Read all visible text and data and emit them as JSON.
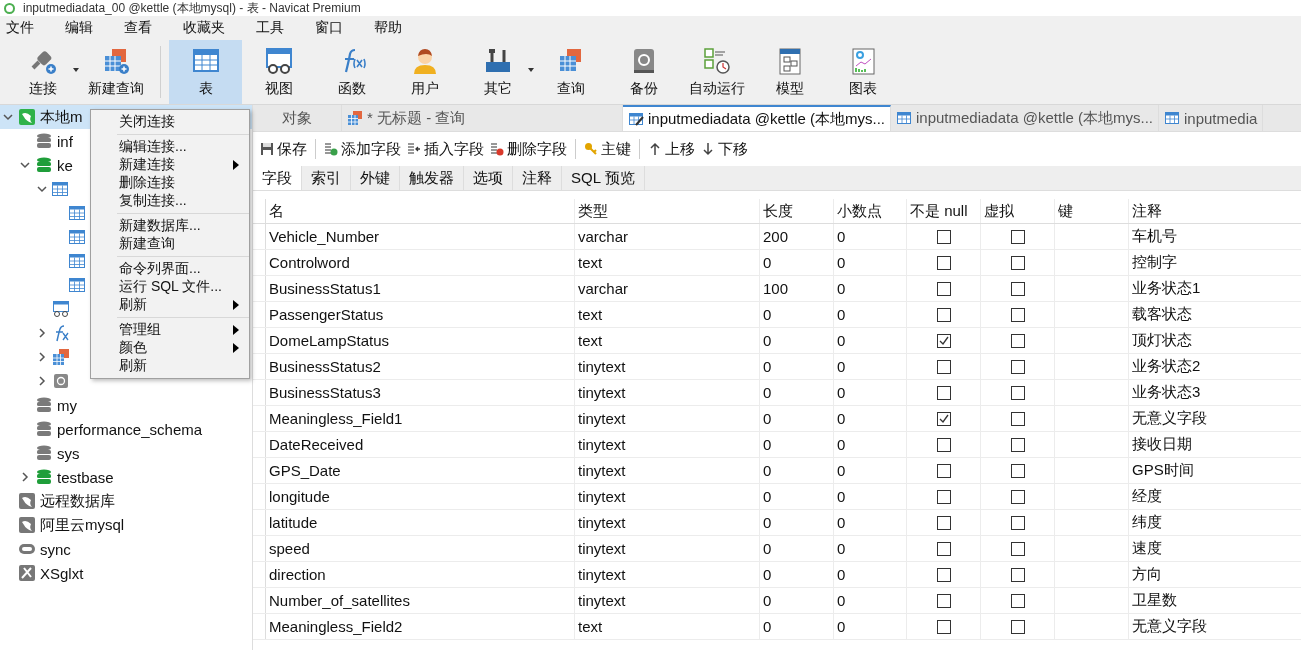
{
  "window": {
    "title": "inputmediadata_00 @kettle (本地mysql) - 表 - Navicat Premium"
  },
  "menu_bar": [
    "文件",
    "编辑",
    "查看",
    "收藏夹",
    "工具",
    "窗口",
    "帮助"
  ],
  "toolbar": [
    {
      "label": "连接",
      "kind": "connect",
      "dropdown": true,
      "selected": false
    },
    {
      "label": "新建查询",
      "kind": "new-query",
      "dropdown": false,
      "selected": false
    },
    {
      "label": "表",
      "kind": "table",
      "dropdown": false,
      "selected": true,
      "group_start": true
    },
    {
      "label": "视图",
      "kind": "view",
      "dropdown": false,
      "selected": false
    },
    {
      "label": "函数",
      "kind": "function",
      "dropdown": false,
      "selected": false
    },
    {
      "label": "用户",
      "kind": "user",
      "dropdown": false,
      "selected": false
    },
    {
      "label": "其它",
      "kind": "other",
      "dropdown": true,
      "selected": false
    },
    {
      "label": "查询",
      "kind": "query",
      "dropdown": false,
      "selected": false
    },
    {
      "label": "备份",
      "kind": "backup",
      "dropdown": false,
      "selected": false
    },
    {
      "label": "自动运行",
      "kind": "schedule",
      "dropdown": false,
      "selected": false
    },
    {
      "label": "模型",
      "kind": "model",
      "dropdown": false,
      "selected": false
    },
    {
      "label": "图表",
      "kind": "chart",
      "dropdown": false,
      "selected": false
    }
  ],
  "sidebar": {
    "tree": [
      {
        "label": "本地m",
        "kind": "connection",
        "open": true,
        "expanded": true,
        "selected": true,
        "children": [
          {
            "label": "inf",
            "kind": "database",
            "open": false,
            "selected": false
          },
          {
            "label": "ke",
            "kind": "database",
            "open": true,
            "expanded": true,
            "selected": false,
            "children": [
              {
                "kind": "tables",
                "expanded": true,
                "selected": false,
                "children": [
                  {
                    "kind": "table",
                    "selected": false
                  },
                  {
                    "kind": "table",
                    "selected": false
                  },
                  {
                    "kind": "table",
                    "selected": false
                  },
                  {
                    "kind": "table",
                    "selected": false
                  }
                ]
              },
              {
                "kind": "views",
                "selected": false
              },
              {
                "kind": "functions",
                "expanded": false,
                "selected": false
              },
              {
                "kind": "queries",
                "expanded": false,
                "selected": false
              },
              {
                "kind": "backups",
                "expanded": false,
                "selected": false
              }
            ]
          },
          {
            "label": "my",
            "kind": "database",
            "open": false,
            "selected": false
          },
          {
            "label": "performance_schema",
            "kind": "database",
            "open": false,
            "selected": false
          },
          {
            "label": "sys",
            "kind": "database",
            "open": false,
            "selected": false
          },
          {
            "label": "testbase",
            "kind": "database",
            "open": true,
            "expanded": false,
            "selected": false
          }
        ]
      },
      {
        "label": "远程数据库",
        "kind": "connection",
        "open": false,
        "selected": false
      },
      {
        "label": "阿里云mysql",
        "kind": "connection",
        "open": false,
        "selected": false
      },
      {
        "label": "sync",
        "kind": "sync",
        "selected": false
      },
      {
        "label": "XSglxt",
        "kind": "tool",
        "selected": false
      }
    ]
  },
  "context_menu": {
    "groups": [
      [
        {
          "label": "关闭连接",
          "submenu": false
        }
      ],
      [
        {
          "label": "编辑连接...",
          "submenu": false
        },
        {
          "label": "新建连接",
          "submenu": true
        },
        {
          "label": "删除连接",
          "submenu": false
        },
        {
          "label": "复制连接...",
          "submenu": false
        }
      ],
      [
        {
          "label": "新建数据库...",
          "submenu": false
        },
        {
          "label": "新建查询",
          "submenu": false
        }
      ],
      [
        {
          "label": "命令列界面...",
          "submenu": false
        },
        {
          "label": "运行 SQL 文件...",
          "submenu": false
        },
        {
          "label": "刷新",
          "submenu": true
        }
      ],
      [
        {
          "label": "管理组",
          "submenu": true
        },
        {
          "label": "颜色",
          "submenu": true
        },
        {
          "label": "刷新",
          "submenu": false
        }
      ]
    ]
  },
  "doc_tabs": [
    {
      "label": "对象",
      "kind": "objects",
      "selected": false
    },
    {
      "label": "* 无标题 - 查询",
      "kind": "query",
      "selected": false
    },
    {
      "label": "inputmediadata @kettle (本地mys...",
      "kind": "design",
      "selected": true
    },
    {
      "label": "inputmediadata @kettle (本地mys...",
      "kind": "table",
      "selected": false
    },
    {
      "label": "inputmedia",
      "kind": "table",
      "selected": false
    }
  ],
  "editor_toolbar": [
    {
      "label": "保存",
      "kind": "save"
    },
    {
      "label": "添加字段",
      "kind": "add",
      "group_start": true
    },
    {
      "label": "插入字段",
      "kind": "insert"
    },
    {
      "label": "删除字段",
      "kind": "delete"
    },
    {
      "label": "主键",
      "kind": "key",
      "group_start": true
    },
    {
      "label": "上移",
      "kind": "up",
      "group_start": true
    },
    {
      "label": "下移",
      "kind": "down"
    }
  ],
  "sub_tabs": [
    {
      "label": "字段",
      "selected": true
    },
    {
      "label": "索引",
      "selected": false
    },
    {
      "label": "外键",
      "selected": false
    },
    {
      "label": "触发器",
      "selected": false
    },
    {
      "label": "选项",
      "selected": false
    },
    {
      "label": "注释",
      "selected": false
    },
    {
      "label": "SQL 预览",
      "selected": false
    }
  ],
  "table": {
    "columns": [
      "名",
      "类型",
      "长度",
      "小数点",
      "不是 null",
      "虚拟",
      "键",
      "注释"
    ],
    "rows": [
      {
        "name": "Vehicle_Number",
        "type": "varchar",
        "length": "200",
        "decimals": "0",
        "not_null": false,
        "virtual": false,
        "comment": "车机号"
      },
      {
        "name": "Controlword",
        "type": "text",
        "length": "0",
        "decimals": "0",
        "not_null": false,
        "virtual": false,
        "comment": "控制字"
      },
      {
        "name": "BusinessStatus1",
        "type": "varchar",
        "length": "100",
        "decimals": "0",
        "not_null": false,
        "virtual": false,
        "comment": "业务状态1"
      },
      {
        "name": "PassengerStatus",
        "type": "text",
        "length": "0",
        "decimals": "0",
        "not_null": false,
        "virtual": false,
        "comment": "载客状态"
      },
      {
        "name": "DomeLampStatus",
        "type": "text",
        "length": "0",
        "decimals": "0",
        "not_null": true,
        "virtual": false,
        "comment": "顶灯状态"
      },
      {
        "name": "BusinessStatus2",
        "type": "tinytext",
        "length": "0",
        "decimals": "0",
        "not_null": false,
        "virtual": false,
        "comment": "业务状态2"
      },
      {
        "name": "BusinessStatus3",
        "type": "tinytext",
        "length": "0",
        "decimals": "0",
        "not_null": false,
        "virtual": false,
        "comment": "业务状态3"
      },
      {
        "name": "Meaningless_Field1",
        "type": "tinytext",
        "length": "0",
        "decimals": "0",
        "not_null": true,
        "virtual": false,
        "comment": "无意义字段"
      },
      {
        "name": "DateReceived",
        "type": "tinytext",
        "length": "0",
        "decimals": "0",
        "not_null": false,
        "virtual": false,
        "comment": "接收日期"
      },
      {
        "name": "GPS_Date",
        "type": "tinytext",
        "length": "0",
        "decimals": "0",
        "not_null": false,
        "virtual": false,
        "comment": "GPS时间"
      },
      {
        "name": "longitude",
        "type": "tinytext",
        "length": "0",
        "decimals": "0",
        "not_null": false,
        "virtual": false,
        "comment": "经度"
      },
      {
        "name": "latitude",
        "type": "tinytext",
        "length": "0",
        "decimals": "0",
        "not_null": false,
        "virtual": false,
        "comment": "纬度"
      },
      {
        "name": "speed",
        "type": "tinytext",
        "length": "0",
        "decimals": "0",
        "not_null": false,
        "virtual": false,
        "comment": "速度"
      },
      {
        "name": "direction",
        "type": "tinytext",
        "length": "0",
        "decimals": "0",
        "not_null": false,
        "virtual": false,
        "comment": "方向"
      },
      {
        "name": "Number_of_satellites",
        "type": "tinytext",
        "length": "0",
        "decimals": "0",
        "not_null": false,
        "virtual": false,
        "comment": "卫星数"
      },
      {
        "name": "Meaningless_Field2",
        "type": "text",
        "length": "0",
        "decimals": "0",
        "not_null": false,
        "virtual": false,
        "comment": "无意义字段"
      }
    ]
  }
}
